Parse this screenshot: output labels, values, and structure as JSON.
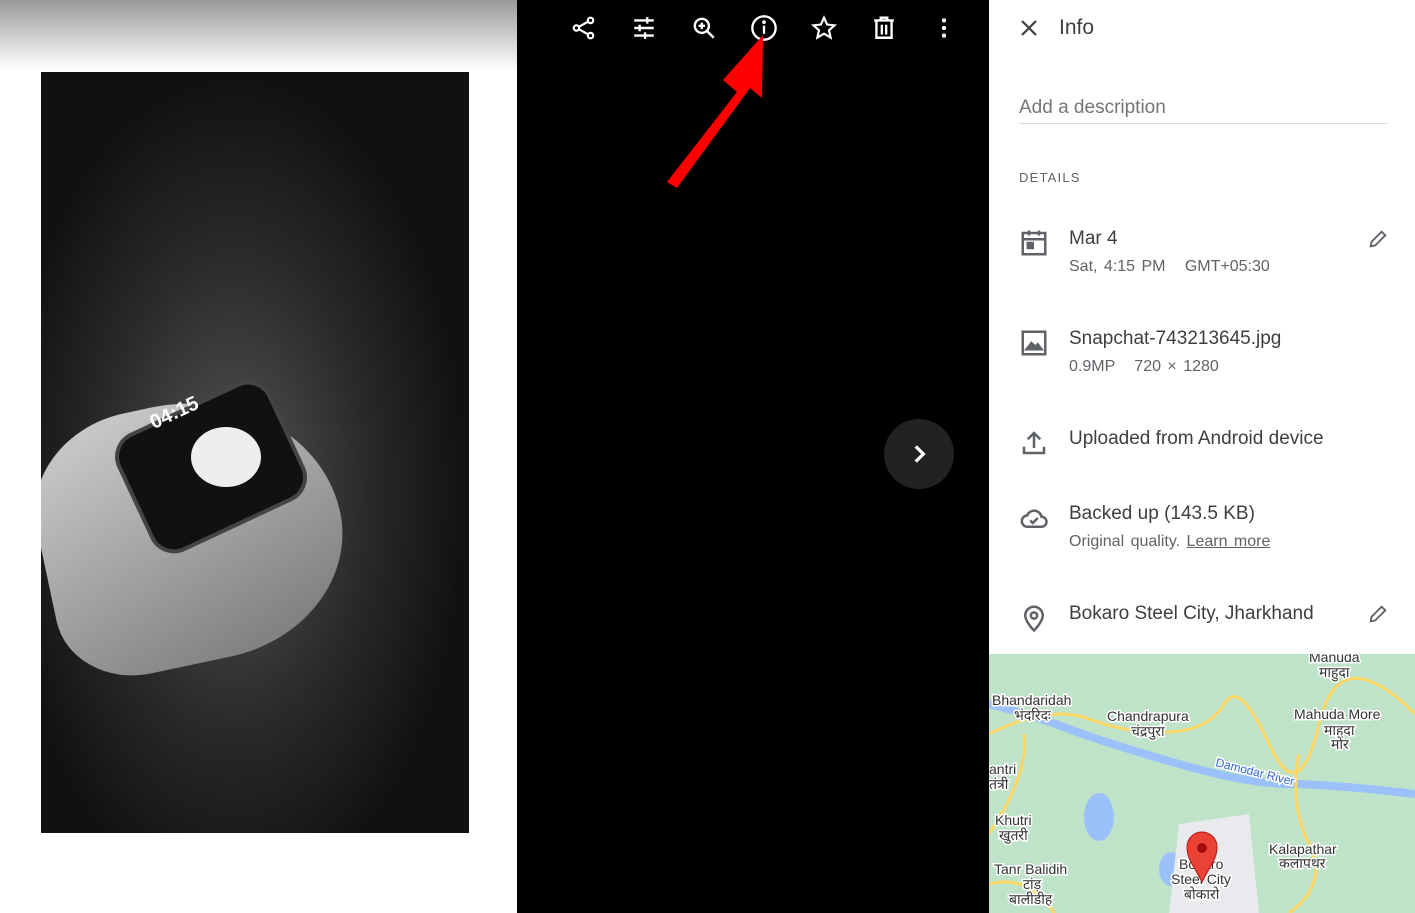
{
  "photo": {
    "watch_time": "04:15"
  },
  "toolbar": {
    "items": [
      {
        "icon": "share-icon"
      },
      {
        "icon": "edit-adjust-icon"
      },
      {
        "icon": "zoom-in-icon"
      },
      {
        "icon": "info-icon"
      },
      {
        "icon": "star-icon"
      },
      {
        "icon": "trash-icon"
      },
      {
        "icon": "more-vertical-icon"
      }
    ]
  },
  "info": {
    "title": "Info",
    "description_placeholder": "Add a description",
    "details_label": "DETAILS",
    "date": {
      "title": "Mar 4",
      "subtitle": "Sat, 4:15 PM   GMT+05:30"
    },
    "file": {
      "title": "Snapchat-743213645.jpg",
      "subtitle": "0.9MP   720 × 1280"
    },
    "upload": {
      "title": "Uploaded from Android device"
    },
    "backup": {
      "title": "Backed up (143.5 KB)",
      "subtitle": "Original quality.",
      "link": "Learn more"
    },
    "location": {
      "title": "Bokaro Steel City, Jharkhand"
    }
  },
  "map": {
    "labels": [
      "Manuda",
      "माहुदा",
      "Bhandaridah",
      "भंदरिदः",
      "Chandrapura",
      "चंद्रपुरा",
      "Mahuda More",
      "माहुदा",
      "मोर",
      "antri",
      "तंत्री",
      "Damodar River",
      "Khutri",
      "खुतरी",
      "Kalapathar",
      "कलापथर",
      "Tanr Balidih",
      "टांड़",
      "बालीडीह",
      "Bokaro",
      "Steel City",
      "बोकारो"
    ]
  },
  "colors": {
    "annotation_arrow": "#ff0000",
    "map_pin": "#ea4335",
    "map_land": "#bfe3c8",
    "map_water": "#9cc0f9",
    "map_road": "#fdd663"
  }
}
